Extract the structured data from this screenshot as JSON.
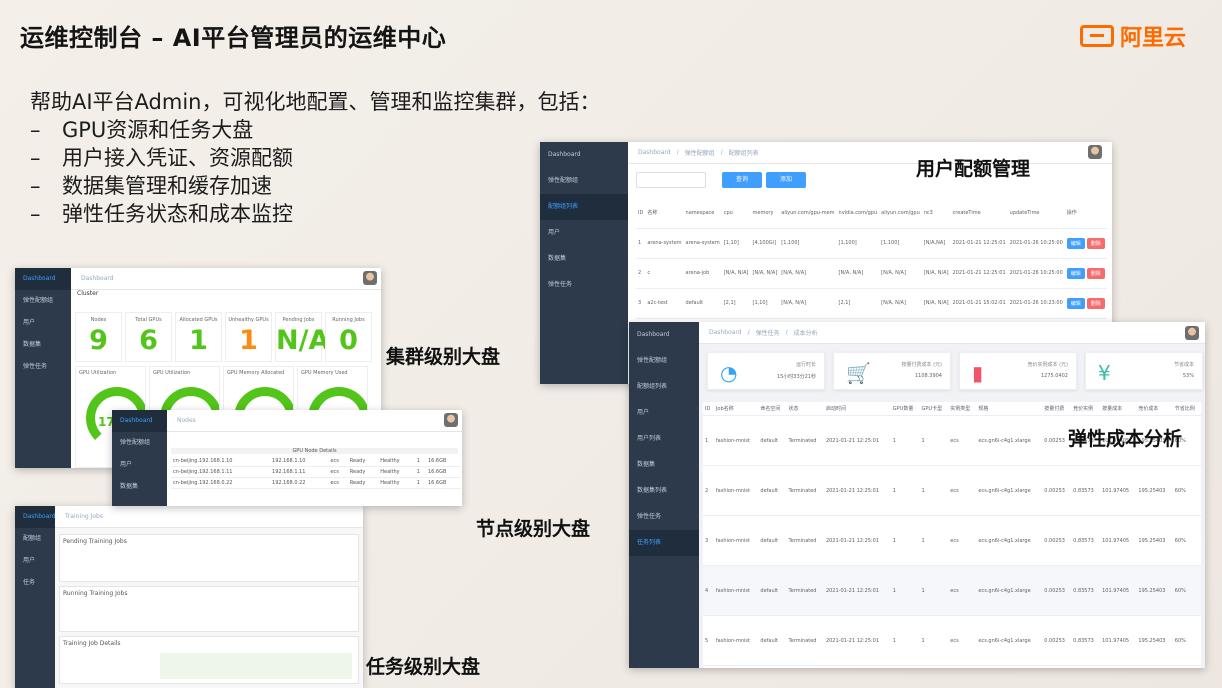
{
  "slide": {
    "title": "运维控制台 – AI平台管理员的运维中心",
    "logo_text": "阿里云",
    "brand_color": "#ff6a00",
    "intro": "帮助AI平台Admin，可视化地配置、管理和监控集群，包括：",
    "bullets": [
      "GPU资源和任务大盘",
      "用户接入凭证、资源配额",
      "数据集管理和缓存加速",
      "弹性任务状态和成本监控"
    ]
  },
  "captions": {
    "cluster": "集群级别大盘",
    "node": "节点级别大盘",
    "job": "任务级别大盘",
    "quota": "用户配额管理",
    "cost": "弹性成本分析"
  },
  "cluster_panel": {
    "title": "Cluster",
    "metrics": [
      {
        "label": "Nodes",
        "value": "9",
        "color": "#52c41a"
      },
      {
        "label": "Total GPUs",
        "value": "6",
        "color": "#52c41a"
      },
      {
        "label": "Allocated GPUs",
        "value": "1",
        "color": "#52c41a"
      },
      {
        "label": "Unhealthy GPUs",
        "value": "1",
        "color": "#fa8c16"
      },
      {
        "label": "Pending Jobs",
        "value": "N/A",
        "color": "#52c41a"
      },
      {
        "label": "Running Jobs",
        "value": "0",
        "color": "#52c41a"
      }
    ],
    "gauges": [
      "GPU Utilization",
      "GPU Utilization",
      "GPU Memory Allocated",
      "GPU Memory Used"
    ],
    "gauge_value": "17"
  },
  "node_panel": {
    "title": "Nodes",
    "table_title": "GPU Node Details",
    "rows": [
      [
        "cn-beijing.192.168.1.10",
        "192.168.1.10",
        "ecs",
        "Ready",
        "Healthy",
        "1",
        "16.6GB"
      ],
      [
        "cn-beijing.192.168.1.11",
        "192.168.1.11",
        "ecs",
        "Ready",
        "Healthy",
        "1",
        "16.6GB"
      ],
      [
        "cn-beijing.192.168.0.22",
        "192.168.0.22",
        "ecs",
        "Ready",
        "Healthy",
        "1",
        "16.6GB"
      ]
    ]
  },
  "job_panel": {
    "title": "Training Jobs",
    "sections": [
      "Pending Training Jobs",
      "Running Training Jobs",
      "Training Job Details"
    ]
  },
  "quota_panel": {
    "breadcrumb": [
      "Dashboard",
      "弹性配额组",
      "配额组列表"
    ],
    "sidebar": [
      "Dashboard",
      "弹性配额组",
      "配额组列表",
      "用户",
      "数据集",
      "弹性任务"
    ],
    "search_button": "查询",
    "add_button": "添加",
    "columns": [
      "ID",
      "名称",
      "namespace",
      "cpu",
      "memory",
      "aliyun.com/gpu-mem",
      "nvidia.com/gpu",
      "aliyun.com/gpu",
      "nc3",
      "createTime",
      "updateTime",
      "操作"
    ],
    "rows": [
      [
        "1",
        "arena-system",
        "arena-system",
        "[1,10]",
        "[4,100Gi]",
        "[1,100]",
        "[1,100]",
        "[1,100]",
        "[N/A,NA]",
        "2021-01-21 12:25:01",
        "2021-01-26 10:25:00"
      ],
      [
        "2",
        "c",
        "arena-job",
        "[N/A, N/A]",
        "[N/A, N/A]",
        "[N/A, N/A]",
        "[N/A, N/A]",
        "[N/A, N/A]",
        "[N/A, N/A]",
        "2021-01-21 12:25:01",
        "2021-01-26 10:25:00"
      ],
      [
        "3",
        "a2c-test",
        "default",
        "[2,1]",
        "[1,10]",
        "[N/A, N/A]",
        "[2,1]",
        "[N/A, N/A]",
        "[N/A, N/A]",
        "2021-01-21 15:02:01",
        "2021-01-26 10:23:00"
      ]
    ],
    "edit_label": "编辑",
    "delete_label": "删除"
  },
  "cost_panel": {
    "breadcrumb": [
      "Dashboard",
      "弹性任务",
      "成本分析"
    ],
    "sidebar": [
      "Dashboard",
      "弹性配额组",
      "配额组列表",
      "用户",
      "用户列表",
      "数据集",
      "数据集列表",
      "弹性任务",
      "任务列表"
    ],
    "stats": [
      {
        "icon": "speedometer",
        "label": "运行时长",
        "value": "15小时33分21秒",
        "color": "#36a3f7"
      },
      {
        "icon": "cart",
        "label": "按量付费成本 (元)",
        "value": "1108.3904",
        "color": "#40c9c6"
      },
      {
        "icon": "bar-chart",
        "label": "竞价实例成本 (元)",
        "value": "1275.0402",
        "color": "#f4516c"
      },
      {
        "icon": "yen",
        "label": "节省成本",
        "value": "53%",
        "color": "#34bfa3"
      }
    ],
    "columns": [
      "ID",
      "Job名称",
      "命名空间",
      "状态",
      "启动时间",
      "GPU数量",
      "GPU卡型",
      "实例类型",
      "规格",
      "按量付费",
      "竞价实例",
      "按量成本",
      "竞价成本",
      "节省比例"
    ],
    "rows": [
      [
        "1",
        "fashion-mnist",
        "default",
        "Terminated",
        "2021-01-21 12:25:01",
        "1",
        "1",
        "ecs",
        "ecs.gn6i-c4g1.xlarge",
        "0.00253",
        "0.83573",
        "101.97405",
        "195.25403",
        "60%"
      ],
      [
        "2",
        "fashion-mnist",
        "default",
        "Terminated",
        "2021-01-21 12:25:01",
        "1",
        "1",
        "ecs",
        "ecs.gn6i-c4g1.xlarge",
        "0.00253",
        "0.83573",
        "101.97405",
        "195.25403",
        "60%"
      ],
      [
        "3",
        "fashion-mnist",
        "default",
        "Terminated",
        "2021-01-21 12:25:01",
        "1",
        "1",
        "ecs",
        "ecs.gn6i-c4g1.xlarge",
        "0.00253",
        "0.83573",
        "101.97405",
        "195.25403",
        "60%"
      ],
      [
        "4",
        "fashion-mnist",
        "default",
        "Terminated",
        "2021-01-21 12:25:01",
        "1",
        "1",
        "ecs",
        "ecs.gn6i-c4g1.xlarge",
        "0.00253",
        "0.83573",
        "101.97405",
        "195.25403",
        "60%"
      ],
      [
        "5",
        "fashion-mnist",
        "default",
        "Terminated",
        "2021-01-21 12:25:01",
        "1",
        "1",
        "ecs",
        "ecs.gn6i-c4g1.xlarge",
        "0.00253",
        "0.83573",
        "101.97405",
        "195.25403",
        "60%"
      ]
    ]
  }
}
